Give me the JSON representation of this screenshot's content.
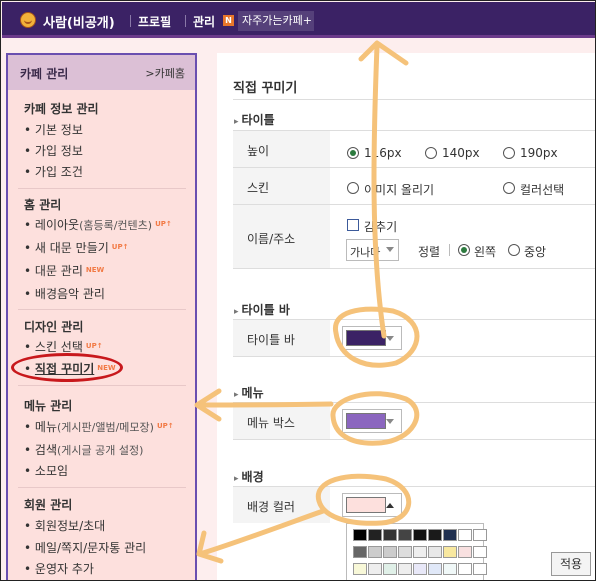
{
  "topbar": {
    "nickname": "사람(비공개)",
    "profile_link": "프로필",
    "admin_link": "관리",
    "admin_badge": "N",
    "favorite_cafe": "자주가는카페+"
  },
  "sidebar": {
    "title": "카페 관리",
    "home_link": ">카페홈",
    "groups": [
      {
        "title": "카페 정보 관리",
        "items": [
          {
            "label": "기본 정보"
          },
          {
            "label": "가입 정보"
          },
          {
            "label": "가입 조건"
          }
        ]
      },
      {
        "title": "홈 관리",
        "items": [
          {
            "label": "레이아웃",
            "sub": "(홈등록/컨텐츠)",
            "badge": "UP↑"
          },
          {
            "label": "새 대문 만들기",
            "badge": "UP↑"
          },
          {
            "label": "대문 관리",
            "badge": "NEW"
          },
          {
            "label": "배경음악 관리"
          }
        ]
      },
      {
        "title": "디자인 관리",
        "items": [
          {
            "label": "스킨 선택",
            "badge": "UP↑"
          },
          {
            "label": "직접 꾸미기",
            "badge": "NEW"
          }
        ]
      },
      {
        "title": "메뉴 관리",
        "items": [
          {
            "label": "메뉴",
            "sub": "(게시판/앨범/메모장)",
            "badge": "UP↑"
          },
          {
            "label": "검색",
            "sub": "(게시글 공개 설정)"
          },
          {
            "label": "소모임"
          }
        ]
      },
      {
        "title": "회원 관리",
        "items": [
          {
            "label": "회원정보/초대"
          },
          {
            "label": "메일/쪽지/문자통 관리"
          },
          {
            "label": "운영자 추가"
          }
        ]
      }
    ]
  },
  "content": {
    "title": "직접 꾸미기",
    "sections": {
      "title_section": "타이틀",
      "titlebar_section": "타이틀 바",
      "menu_section": "메뉴",
      "background_section": "배경"
    },
    "height": {
      "label": "높이",
      "options": [
        "116px",
        "140px",
        "190px"
      ],
      "selected": "116px"
    },
    "skin": {
      "label": "스킨",
      "options": [
        "이미지 올리기",
        "컬러선택"
      ]
    },
    "name_address": {
      "label": "이름/주소",
      "hide_label": "감추기",
      "font_select": "가나다",
      "align_label": "정렬",
      "align_options": [
        "왼쪽",
        "중앙"
      ],
      "align_selected": "왼쪽"
    },
    "titlebar": {
      "label": "타이틀 바",
      "color": "#3b2265"
    },
    "menu_box": {
      "label": "메뉴 박스",
      "color": "#8b66bf"
    },
    "background": {
      "label": "배경 컬러",
      "color": "#fde0dd"
    },
    "palette": {
      "rows": [
        [
          "#000000",
          "#222222",
          "#333333",
          "#444444",
          "#111111",
          "#1a1a1a",
          "#203050",
          "#ffffff",
          "#ffffff"
        ],
        [
          "#666666",
          "#cccccc",
          "#cccccc",
          "#dddddd",
          "#eeeeee",
          "#e8e8e8",
          "#f8e8a0",
          "#f8e0e0",
          "#ffffff"
        ],
        [
          "#f8f8d8",
          "#eeeeee",
          "#e0f0e8",
          "#eeeeee",
          "#e8e8f8",
          "#e0e8f8",
          "#f0f8f8",
          "#ffffff",
          "#ffffff"
        ]
      ]
    },
    "apply_button": "적용"
  },
  "colors": {
    "topbar_bg": "#3b2265",
    "sidebar_bg": "#fde0dd",
    "sidebar_border": "#6a4fb0",
    "annotation_orange": "#f5c27a",
    "annotation_red": "#c8181c"
  }
}
